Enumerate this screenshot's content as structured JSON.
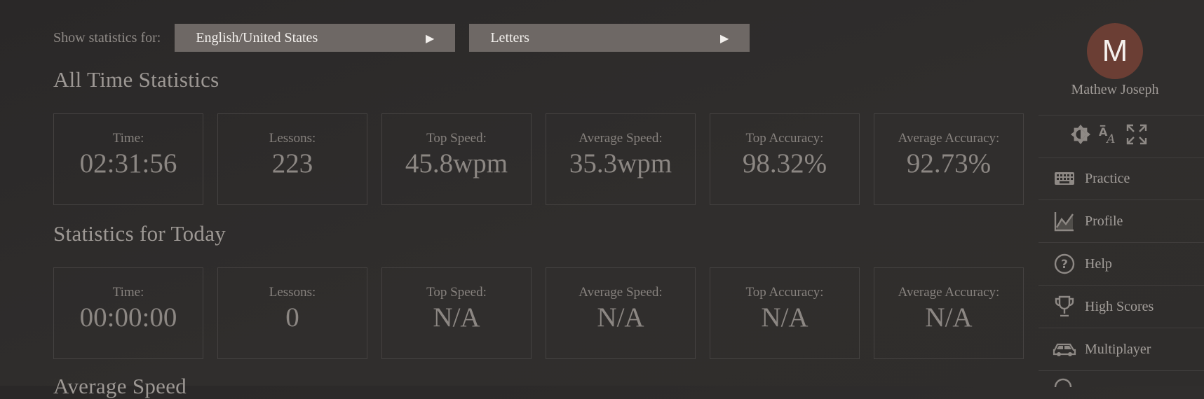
{
  "filters": {
    "label": "Show statistics for:",
    "language": "English/United States",
    "mode": "Letters",
    "arrow_glyph": "▶"
  },
  "all_time": {
    "title": "All Time Statistics",
    "stats": [
      {
        "label": "Time:",
        "value": "02:31:56"
      },
      {
        "label": "Lessons:",
        "value": "223"
      },
      {
        "label": "Top Speed:",
        "value": "45.8wpm"
      },
      {
        "label": "Average Speed:",
        "value": "35.3wpm"
      },
      {
        "label": "Top Accuracy:",
        "value": "98.32%"
      },
      {
        "label": "Average Accuracy:",
        "value": "92.73%"
      }
    ]
  },
  "today": {
    "title": "Statistics for Today",
    "stats": [
      {
        "label": "Time:",
        "value": "00:00:00"
      },
      {
        "label": "Lessons:",
        "value": "0"
      },
      {
        "label": "Top Speed:",
        "value": "N/A"
      },
      {
        "label": "Average Speed:",
        "value": "N/A"
      },
      {
        "label": "Top Accuracy:",
        "value": "N/A"
      },
      {
        "label": "Average Accuracy:",
        "value": "N/A"
      }
    ]
  },
  "next_section": {
    "title": "Average Speed"
  },
  "user": {
    "initial": "M",
    "name": "Mathew Joseph",
    "avatar_color": "#6b3e34"
  },
  "tools": [
    {
      "icon": "brightness-icon"
    },
    {
      "icon": "font-size-icon"
    },
    {
      "icon": "fullscreen-icon"
    }
  ],
  "nav": [
    {
      "label": "Practice",
      "icon": "keyboard-icon"
    },
    {
      "label": "Profile",
      "icon": "chart-icon"
    },
    {
      "label": "Help",
      "icon": "help-icon"
    },
    {
      "label": "High Scores",
      "icon": "trophy-icon"
    },
    {
      "label": "Multiplayer",
      "icon": "car-icon"
    }
  ],
  "colors": {
    "background": "#2f2d2c",
    "select_bg": "#6e6865",
    "avatar": "#6b3e34",
    "text": "#9a9591"
  }
}
